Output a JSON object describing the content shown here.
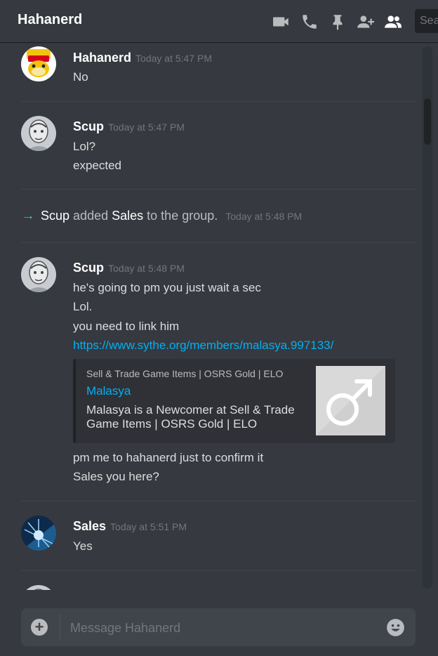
{
  "header": {
    "title": "Hahanerd",
    "icons": [
      "video-call-icon",
      "voice-call-icon",
      "pinned-messages-icon",
      "add-friend-icon",
      "member-list-icon"
    ],
    "search_placeholder": "Search"
  },
  "messages": [
    {
      "author": "Hahanerd",
      "timestamp": "Today at 5:47 PM",
      "lines": [
        "No"
      ]
    },
    {
      "author": "Scup",
      "timestamp": "Today at 5:47 PM",
      "lines": [
        "Lol?",
        "expected"
      ]
    },
    {
      "system": {
        "actor": "Scup",
        "verb": "added",
        "target": "Sales",
        "suffix": "to the group.",
        "timestamp": "Today at 5:48 PM"
      }
    },
    {
      "author": "Scup",
      "timestamp": "Today at 5:48 PM",
      "lines": [
        "he's going to pm you just wait a sec",
        "Lol.",
        "you need to link him"
      ],
      "link": "https://www.sythe.org/members/malasya.997133/",
      "embed": {
        "provider": "Sell & Trade Game Items | OSRS Gold | ELO",
        "title": "Malasya",
        "description": "Malasya is a Newcomer at Sell & Trade Game Items | OSRS Gold | ELO"
      },
      "after_lines": [
        "pm me to hahanerd just to confirm it",
        "Sales you here?"
      ]
    },
    {
      "author": "Sales",
      "timestamp": "Today at 5:51 PM",
      "lines": [
        "Yes"
      ]
    }
  ],
  "composer": {
    "placeholder": "Message Hahanerd"
  },
  "colors": {
    "background": "#36393f",
    "link": "#00b0f4",
    "system_arrow": "#43b581",
    "embed_bg": "#2f3136"
  }
}
